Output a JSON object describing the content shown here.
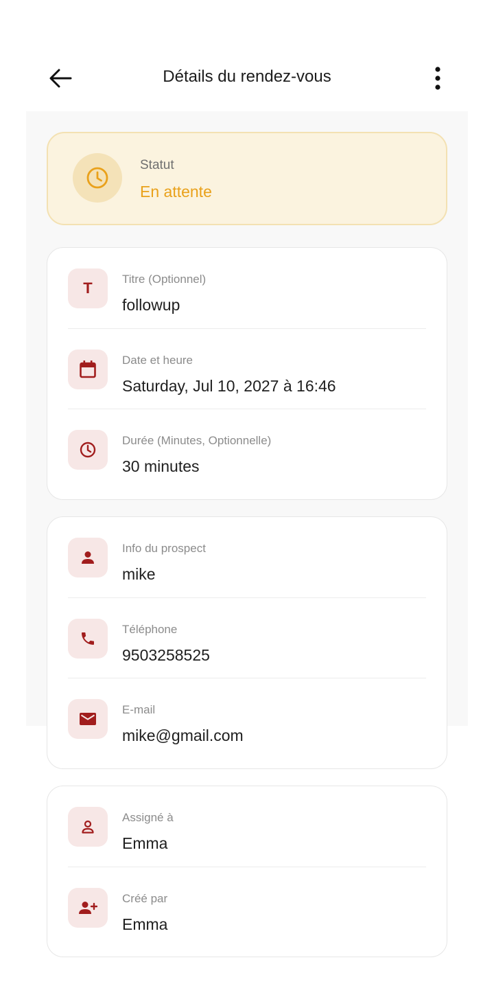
{
  "header": {
    "title": "Détails du rendez-vous",
    "back_icon": "arrow-left-icon",
    "more_icon": "more-vert-icon"
  },
  "status": {
    "label": "Statut",
    "value": "En attente",
    "icon": "clock-icon",
    "color": "#e9a11b"
  },
  "appointment": {
    "title_label": "Titre (Optionnel)",
    "title_value": "followup",
    "datetime_label": "Date et heure",
    "datetime_value": "Saturday, Jul 10, 2027 à 16:46",
    "duration_label": "Durée (Minutes, Optionnelle)",
    "duration_value": "30 minutes",
    "title_icon_glyph": "T"
  },
  "prospect": {
    "info_label": "Info du prospect",
    "info_value": "mike",
    "phone_label": "Téléphone",
    "phone_value": "9503258525",
    "email_label": "E-mail",
    "email_value": "mike@gmail.com"
  },
  "assignment": {
    "assigned_label": "Assigné à",
    "assigned_value": "Emma",
    "created_label": "Créé par",
    "created_value": "Emma"
  },
  "colors": {
    "accent": "#a11d1d",
    "icon_bg": "#f7e7e6",
    "status_bg": "#fbf3df"
  }
}
